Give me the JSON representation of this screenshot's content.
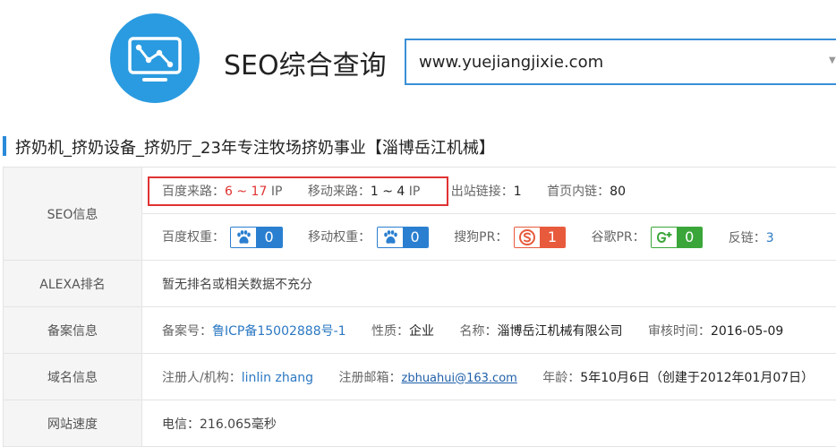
{
  "header": {
    "title": "SEO综合查询",
    "url_value": "www.yuejiangjixie.com"
  },
  "page": {
    "heading": "挤奶机_挤奶设备_挤奶厅_23年专注牧场挤奶事业【淄博岳江机械】"
  },
  "seo": {
    "label": "SEO信息",
    "baidu_traffic_label": "百度来路：",
    "baidu_traffic_value": "6 ~ 17",
    "ip_unit": "IP",
    "mobile_traffic_label": "移动来路：",
    "mobile_traffic_value": "1 ~ 4",
    "outbound_label": "出站链接：",
    "outbound_value": "1",
    "internal_label": "首页内链：",
    "internal_value": "80",
    "baidu_weight_label": "百度权重：",
    "baidu_weight_value": "0",
    "mobile_weight_label": "移动权重：",
    "mobile_weight_value": "0",
    "sogou_pr_label": "搜狗PR：",
    "sogou_pr_value": "1",
    "google_pr_label": "谷歌PR：",
    "google_pr_value": "0",
    "backlinks_label": "反链：",
    "backlinks_value": "3"
  },
  "alexa": {
    "label": "ALEXA排名",
    "value": "暂无排名或相关数据不充分"
  },
  "icp": {
    "label": "备案信息",
    "number_label": "备案号：",
    "number_value": "鲁ICP备15002888号-1",
    "nature_label": "性质：",
    "nature_value": "企业",
    "name_label": "名称：",
    "name_value": "淄博岳江机械有限公司",
    "review_label": "审核时间：",
    "review_value": "2016-05-09"
  },
  "domain": {
    "label": "域名信息",
    "registrant_label": "注册人/机构：",
    "registrant_value": "linlin zhang",
    "email_label": "注册邮箱：",
    "email_value": "zbhuahui@163.com",
    "age_label": "年龄：",
    "age_value": "5年10月6日",
    "created_value": "（创建于2012年01月07日）"
  },
  "speed": {
    "label": "网站速度",
    "value": "电信：216.065毫秒"
  },
  "icons": {
    "logo": "chart-monitor-icon",
    "baidu": "baidu-paw-icon",
    "sogou": "sogou-s-icon",
    "google": "google-plus-icon"
  },
  "colors": {
    "brand": "#2a9be0",
    "highlight": "#e03232",
    "link": "#2b78c2",
    "sogou": "#e85a3c",
    "google": "#3aa63a"
  }
}
